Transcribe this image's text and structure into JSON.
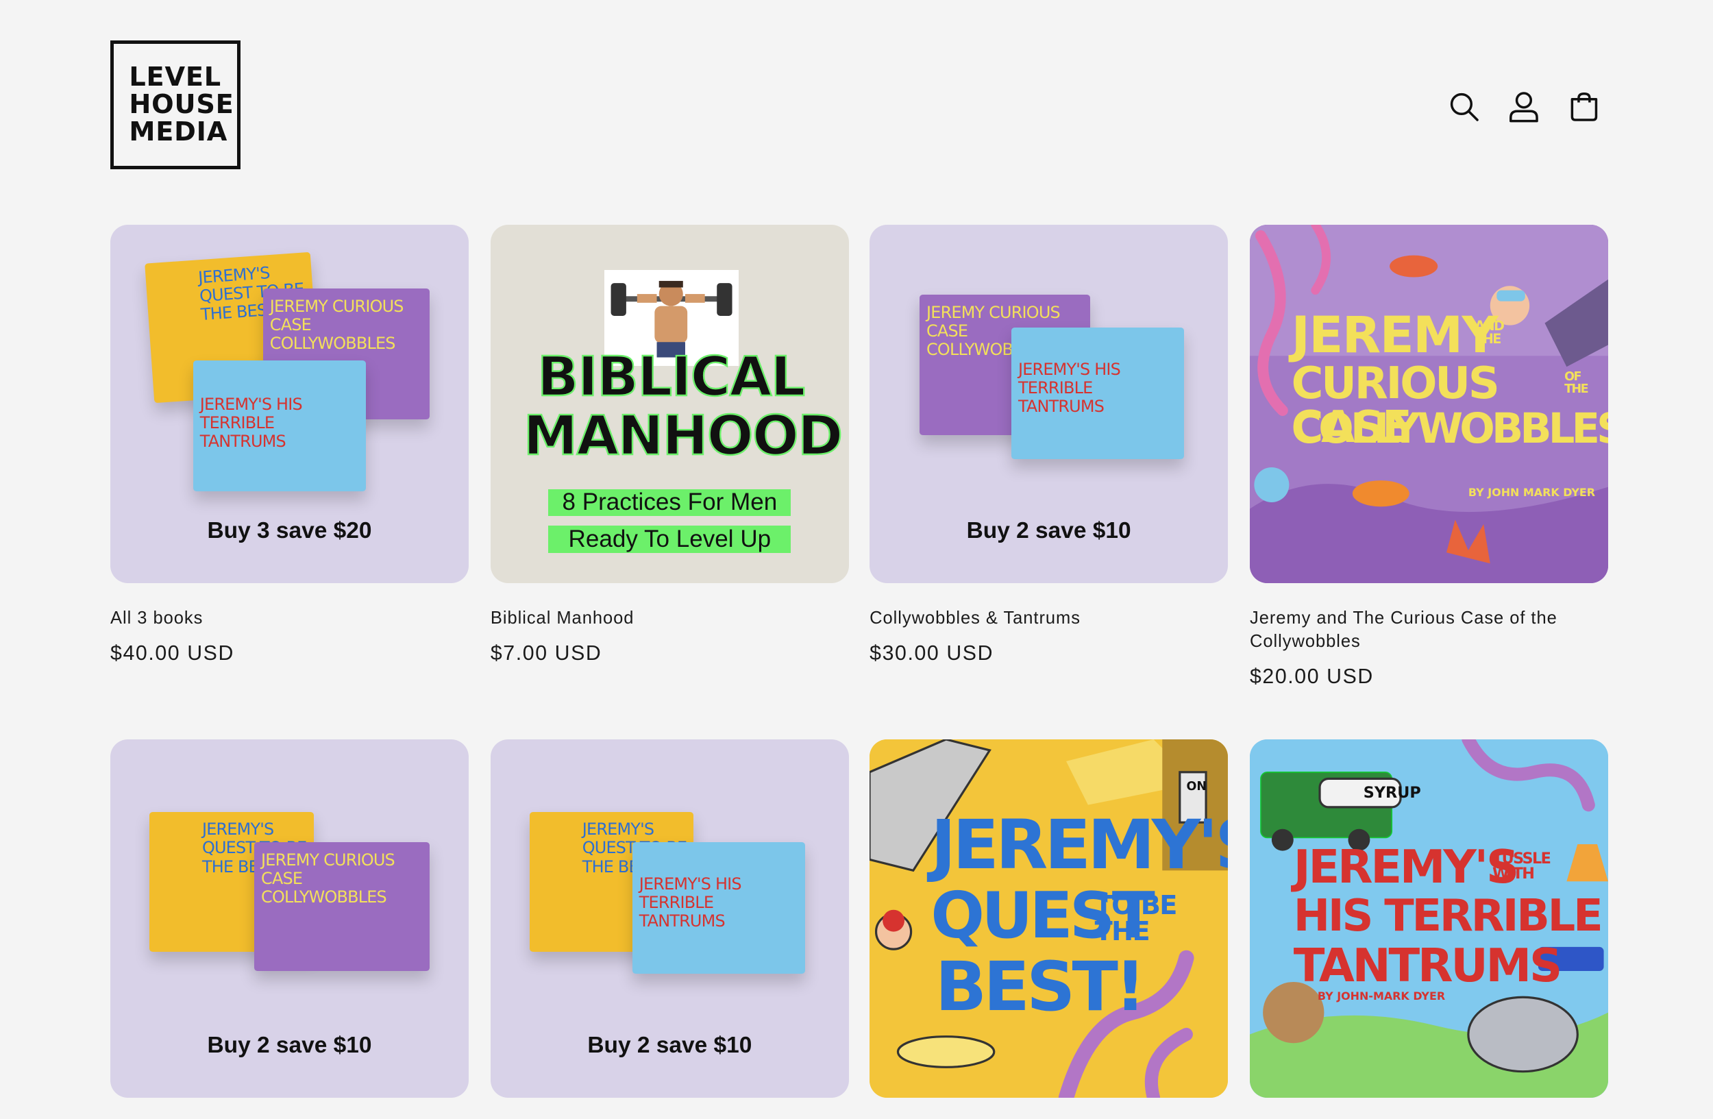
{
  "header": {
    "logo_lines": [
      "LEVEL",
      "HOUSE",
      "MEDIA"
    ],
    "icons": [
      "search-icon",
      "account-icon",
      "cart-icon"
    ]
  },
  "colors": {
    "background": "#f4f4f4",
    "bundle_card": "#d8d2e8",
    "manhood_card": "#e2dfd6",
    "highlight_green": "#6cf06a"
  },
  "products": [
    {
      "title": "All 3 books",
      "price": "$40.00 USD",
      "promo": "Buy 3 save $20"
    },
    {
      "title": "Biblical Manhood",
      "price": "$7.00 USD",
      "cover": {
        "line1": "BIBLICAL",
        "line2": "MANHOOD",
        "sub1": "8 Practices For Men",
        "sub2": "Ready To Level Up"
      }
    },
    {
      "title": "Collywobbles & Tantrums",
      "price": "$30.00 USD",
      "promo": "Buy 2 save $10"
    },
    {
      "title": "Jeremy and The Curious Case of the Collywobbles",
      "price": "$20.00 USD",
      "cover": {
        "line1": "JEREMY",
        "and_the": "AND THE",
        "line2": "CURIOUS CASE",
        "of_the": "OF THE",
        "line3": "COLLYWOBBLES",
        "author": "BY JOHN MARK DYER"
      }
    },
    {
      "promo": "Buy 2 save $10"
    },
    {
      "promo": "Buy 2 save $10"
    },
    {
      "cover": {
        "line1": "JEREMY'S",
        "line2": "QUEST",
        "to_be": "TO BE THE",
        "line3": "BEST!",
        "switch": "ON"
      }
    },
    {
      "cover": {
        "line1": "JEREMY'S",
        "tussle": "TUSSLE WITH",
        "line2": "HIS TERRIBLE",
        "line3": "TANTRUMS",
        "author": "BY JOHN-MARK DYER",
        "truck": "SYRUP"
      }
    }
  ],
  "mini_books": {
    "quest": "JEREMY'S QUEST TO BE THE BEST",
    "collywobbles": "JEREMY CURIOUS CASE COLLYWOBBLES",
    "tantrums": "JEREMY'S HIS TERRIBLE TANTRUMS"
  }
}
